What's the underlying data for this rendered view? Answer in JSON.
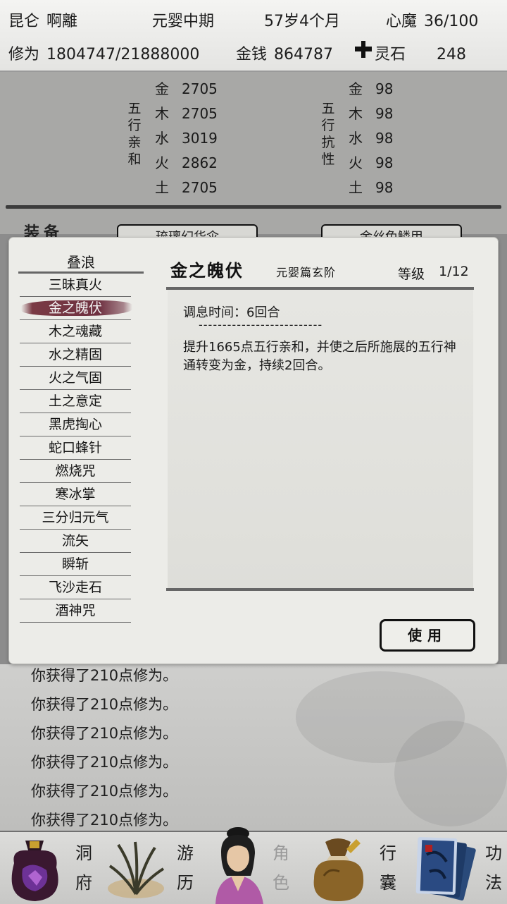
{
  "header": {
    "sect": "昆仑",
    "name": "啊離",
    "realm": "元婴中期",
    "age": "57岁4个月",
    "heart_demon_label": "心魔",
    "heart_demon_value": "36/100",
    "cultivation_label": "修为",
    "cultivation_value": "1804747/21888000",
    "money_label": "金钱",
    "money_value": "864787",
    "spirit_stone_label": "灵石",
    "spirit_stone_value": "248"
  },
  "stats": {
    "affinity_label": "五行亲和",
    "resist_label": "五行抗性",
    "affinity": [
      {
        "element": "金",
        "value": "2705"
      },
      {
        "element": "木",
        "value": "2705"
      },
      {
        "element": "水",
        "value": "3019"
      },
      {
        "element": "火",
        "value": "2862"
      },
      {
        "element": "土",
        "value": "2705"
      }
    ],
    "resist": [
      {
        "element": "金",
        "value": "98"
      },
      {
        "element": "木",
        "value": "98"
      },
      {
        "element": "水",
        "value": "98"
      },
      {
        "element": "火",
        "value": "98"
      },
      {
        "element": "土",
        "value": "98"
      }
    ],
    "equip_label": "装备",
    "equip_slot_1": "琉璃幻华伞",
    "equip_slot_2": "金丝兔鳞甲"
  },
  "skill_list": {
    "title": "叠浪",
    "items": [
      "三昧真火",
      "金之魄伏",
      "木之魂藏",
      "水之精固",
      "火之气固",
      "土之意定",
      "黑虎掏心",
      "蛇口蜂针",
      "燃烧咒",
      "寒冰掌",
      "三分归元气",
      "流矢",
      "瞬斩",
      "飞沙走石",
      "酒神咒"
    ],
    "selected_index": 1
  },
  "skill_detail": {
    "name": "金之魄伏",
    "rank": "元婴篇玄阶",
    "level_label": "等级",
    "level": "1/12",
    "cooldown": "调息时间：6回合",
    "separator": "--------------------------",
    "effect": "提升1665点五行亲和，并使之后所施展的五行神通转变为金，持续2回合。",
    "use_label": "使用"
  },
  "log": [
    "你获得了210点修为。",
    "你获得了210点修为。",
    "你获得了210点修为。",
    "你获得了210点修为。",
    "你获得了210点修为。",
    "你获得了210点修为。"
  ],
  "nav": [
    {
      "label1": "洞",
      "label2": "府",
      "icon": "treasure-pouch-icon"
    },
    {
      "label1": "游",
      "label2": "历",
      "icon": "grass-icon"
    },
    {
      "label1": "角",
      "label2": "色",
      "icon": "character-portrait-icon"
    },
    {
      "label1": "行",
      "label2": "囊",
      "icon": "bag-icon"
    },
    {
      "label1": "功",
      "label2": "法",
      "icon": "books-icon"
    }
  ],
  "colors": {
    "selected_brush": "#7a3a44",
    "dialog_bg": "#ecece8",
    "overlay_dim": "#8c8c8c"
  }
}
